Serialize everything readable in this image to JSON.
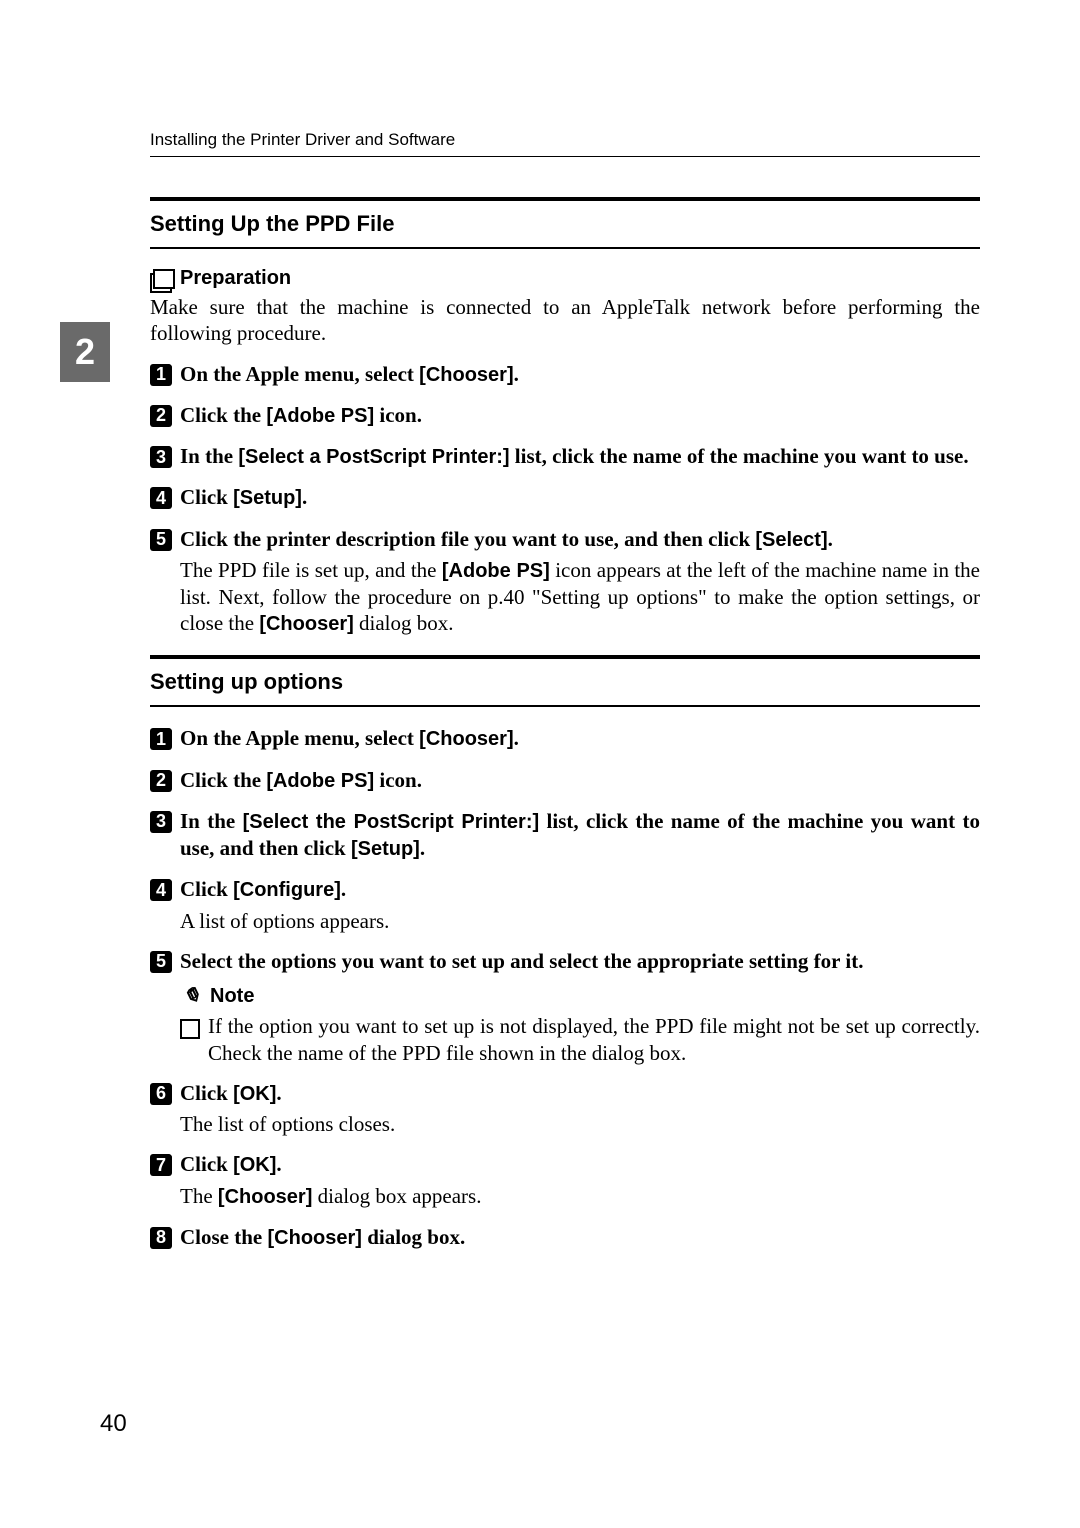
{
  "chapter_tab": "2",
  "page_number": "40",
  "running_head": "Installing the Printer Driver and Software",
  "section1": {
    "title": "Setting Up the PPD File",
    "preparation_label": "Preparation",
    "preparation_body": "Make sure that the machine is connected to an AppleTalk network before performing the following procedure.",
    "steps": {
      "s1": {
        "num": "1",
        "pre": "On the Apple menu, select ",
        "btn": "[Chooser]",
        "post": "."
      },
      "s2": {
        "num": "2",
        "pre": "Click the ",
        "btn": "[Adobe PS]",
        "post": " icon."
      },
      "s3": {
        "num": "3",
        "pre": "In the ",
        "btn": "[Select a PostScript Printer:]",
        "post": " list, click the name of the machine you want to use."
      },
      "s4": {
        "num": "4",
        "pre": "Click ",
        "btn": "[Setup]",
        "post": "."
      },
      "s5": {
        "num": "5",
        "pre": "Click the printer description file you want to use, and then click ",
        "btn": "[Select]",
        "post": "."
      }
    },
    "after5": {
      "a": "The PPD file is set up, and the ",
      "b": "[Adobe PS]",
      "c": " icon appears at the left of the machine name in the list. Next, follow the procedure on p.40 \"Setting up options\" to make the option settings, or close the ",
      "d": "[Chooser]",
      "e": " dialog box."
    }
  },
  "section2": {
    "title": "Setting up options",
    "steps": {
      "s1": {
        "num": "1",
        "pre": "On the Apple menu, select ",
        "btn": "[Chooser]",
        "post": "."
      },
      "s2": {
        "num": "2",
        "pre": "Click the ",
        "btn": "[Adobe PS]",
        "post": " icon."
      },
      "s3": {
        "num": "3",
        "pre": "In the ",
        "btn": "[Select the PostScript Printer:]",
        "mid": " list, click the name of the machine you want to use, and then click ",
        "btn2": "[Setup]",
        "post": "."
      },
      "s4": {
        "num": "4",
        "pre": "Click ",
        "btn": "[Configure]",
        "post": ".",
        "body": "A list of options appears."
      },
      "s5": {
        "num": "5",
        "pre": "Select the options you want to set up and select the appropriate setting for it."
      },
      "s6": {
        "num": "6",
        "pre": "Click ",
        "btn": "[OK]",
        "post": ".",
        "body": "The list of options closes."
      },
      "s7": {
        "num": "7",
        "pre": "Click ",
        "btn": "[OK]",
        "post": ".",
        "body_a": "The ",
        "body_b": "[Chooser]",
        "body_c": " dialog box appears."
      },
      "s8": {
        "num": "8",
        "pre": "Close the ",
        "btn": "[Chooser]",
        "post": " dialog box."
      }
    },
    "note_label": "Note",
    "note_body": "If the option you want to set up is not displayed, the PPD file might not be set up correctly. Check the name of the PPD file shown in the dialog box."
  }
}
